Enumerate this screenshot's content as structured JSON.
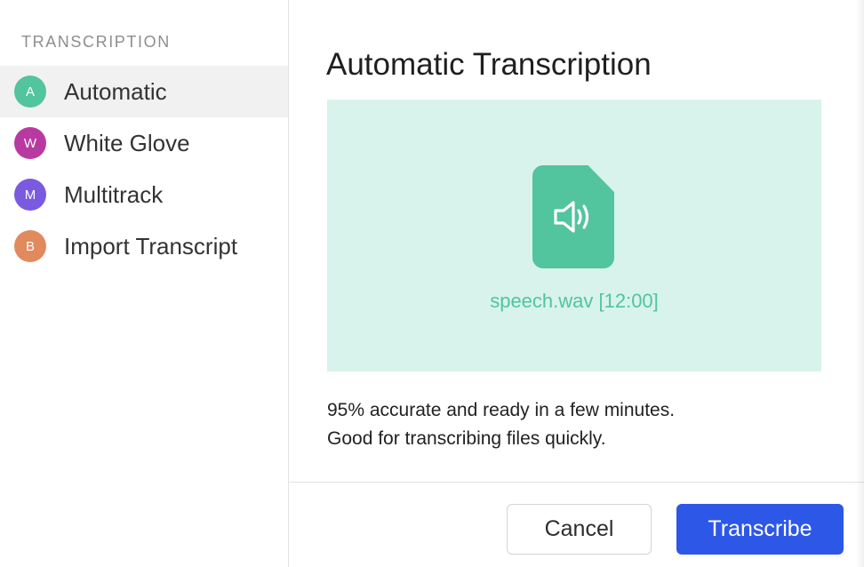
{
  "sidebar": {
    "heading": "TRANSCRIPTION",
    "items": [
      {
        "badge": "A",
        "label": "Automatic",
        "color": "#52c49e",
        "active": true
      },
      {
        "badge": "W",
        "label": "White Glove",
        "color": "#b83aa0",
        "active": false
      },
      {
        "badge": "M",
        "label": "Multitrack",
        "color": "#7a5ae0",
        "active": false
      },
      {
        "badge": "B",
        "label": "Import Transcript",
        "color": "#e08a5e",
        "active": false
      }
    ]
  },
  "main": {
    "title": "Automatic Transcription",
    "preview": {
      "icon": "audio-file-icon",
      "file_name": "speech.wav [12:00]",
      "background_color": "#d8f3ec",
      "accent_color": "#52c49e"
    },
    "description": {
      "line1": "95% accurate and ready in a few minutes.",
      "line2": "Good for transcribing files quickly."
    }
  },
  "footer": {
    "cancel_label": "Cancel",
    "submit_label": "Transcribe",
    "primary_color": "#2d57e6"
  }
}
